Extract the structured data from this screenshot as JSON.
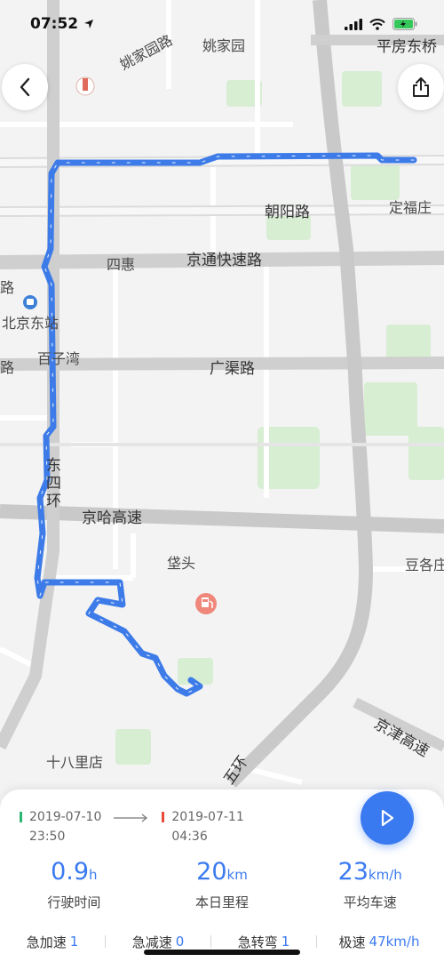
{
  "status_bar": {
    "time": "07:52"
  },
  "map": {
    "labels": {
      "yaojiayuan": "姚家园",
      "yaojiayuan_road": "姚家园路",
      "pingfang_dongqiao": "平房东桥",
      "chaoyang_road": "朝阳路",
      "dingfuzhuang": "定福庄",
      "sihui": "四惠",
      "jingtong_expressway": "京通快速路",
      "beijing_east_station": "北京东站",
      "baiziwan": "百子湾",
      "guangqu_road": "广渠路",
      "dongsihuan": "东四环",
      "jingha_expressway": "京哈高速",
      "guaitou": "垡头",
      "dougezhuang": "豆各庄",
      "jingjin_expressway": "京津高速",
      "shibalidian": "十八里店",
      "wuhuan": "五环",
      "road_fragment_a": "路",
      "road_fragment_b": "路"
    }
  },
  "trip": {
    "start_date": "2019-07-10",
    "start_time": "23:50",
    "end_date": "2019-07-11",
    "end_time": "04:36",
    "stats": [
      {
        "value": "0.9",
        "unit": "h",
        "label": "行驶时间"
      },
      {
        "value": "20",
        "unit": "km",
        "label": "本日里程"
      },
      {
        "value": "23",
        "unit": "km/h",
        "label": "平均车速"
      }
    ],
    "events": [
      {
        "label": "急加速",
        "value": "1"
      },
      {
        "label": "急减速",
        "value": "0"
      },
      {
        "label": "急转弯",
        "value": "1"
      },
      {
        "label": "极速",
        "value": "47km/h"
      }
    ]
  },
  "colors": {
    "accent": "#3a7af0",
    "route": "#3d7ce8",
    "start_marker": "#2bb673",
    "end_marker": "#e84a3c"
  }
}
